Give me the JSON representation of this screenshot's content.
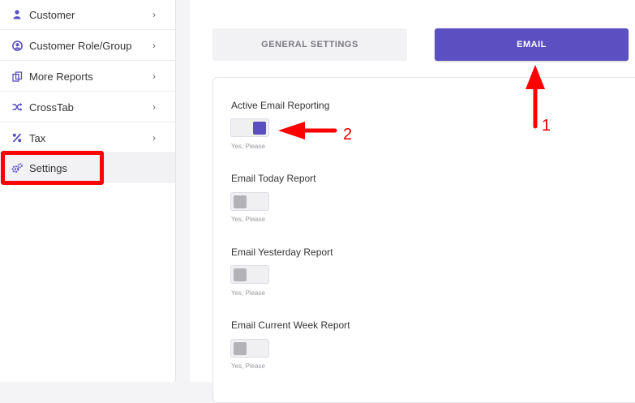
{
  "sidebar": {
    "items": [
      {
        "label": "Customer",
        "icon": "user-icon"
      },
      {
        "label": "Customer Role/Group",
        "icon": "user-circle-icon"
      },
      {
        "label": "More Reports",
        "icon": "copy-icon"
      },
      {
        "label": "CrossTab",
        "icon": "shuffle-icon"
      },
      {
        "label": "Tax",
        "icon": "percent-icon"
      },
      {
        "label": "Settings",
        "icon": "gears-icon"
      }
    ],
    "chevron": "›"
  },
  "tabs": {
    "general": "GENERAL SETTINGS",
    "email": "EMAIL"
  },
  "settings": [
    {
      "label": "Active Email Reporting",
      "sub": "Yes, Please",
      "on": true
    },
    {
      "label": "Email Today Report",
      "sub": "Yes, Please",
      "on": false
    },
    {
      "label": "Email Yesterday Report",
      "sub": "Yes, Please",
      "on": false
    },
    {
      "label": "Email Current Week Report",
      "sub": "Yes, Please",
      "on": false
    }
  ],
  "annotations": {
    "one": "1",
    "two": "2"
  },
  "colors": {
    "accent": "#5b4fc1",
    "annotation": "#ff0000"
  }
}
